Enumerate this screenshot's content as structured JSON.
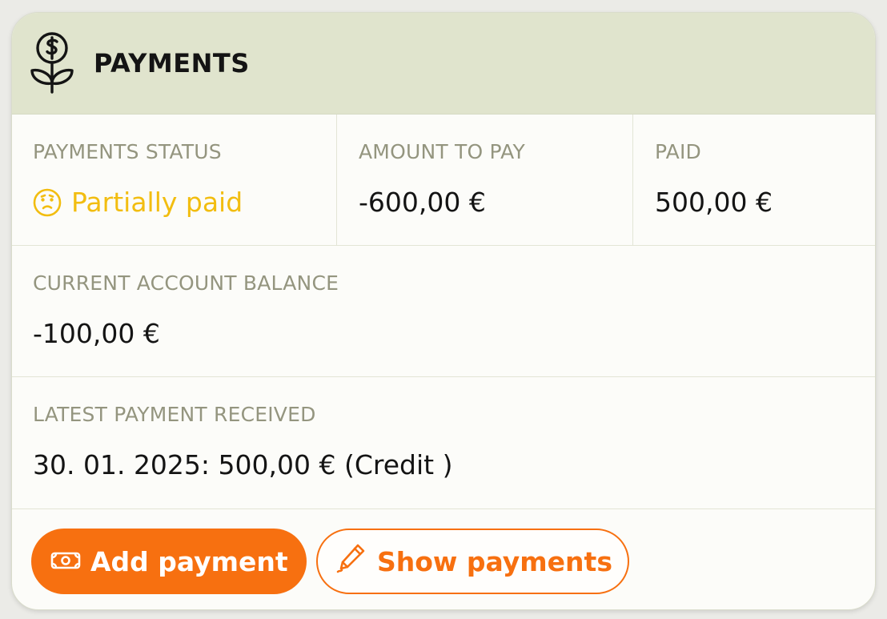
{
  "header": {
    "title": "PAYMENTS",
    "icon": "money-plant-icon"
  },
  "payments_status": {
    "label": "PAYMENTS STATUS",
    "value": "Partially paid",
    "icon": "worried-face-icon",
    "color": "#f2bd10"
  },
  "amount_to_pay": {
    "label": "AMOUNT TO PAY",
    "value": "-600,00 €"
  },
  "paid": {
    "label": "PAID",
    "value": "500,00 €"
  },
  "current_balance": {
    "label": "CURRENT ACCOUNT BALANCE",
    "value": "-100,00 €"
  },
  "latest_payment": {
    "label": "LATEST PAYMENT RECEIVED",
    "value": "30. 01. 2025: 500,00 € (Credit )"
  },
  "actions": {
    "add_payment": {
      "label": "Add payment",
      "icon": "banknote-icon"
    },
    "show_payments": {
      "label": "Show payments",
      "icon": "pencil-icon"
    }
  },
  "colors": {
    "accent": "#f77010",
    "header_bg": "#e0e4cd",
    "label": "#94957f",
    "warning": "#f2bd10"
  }
}
